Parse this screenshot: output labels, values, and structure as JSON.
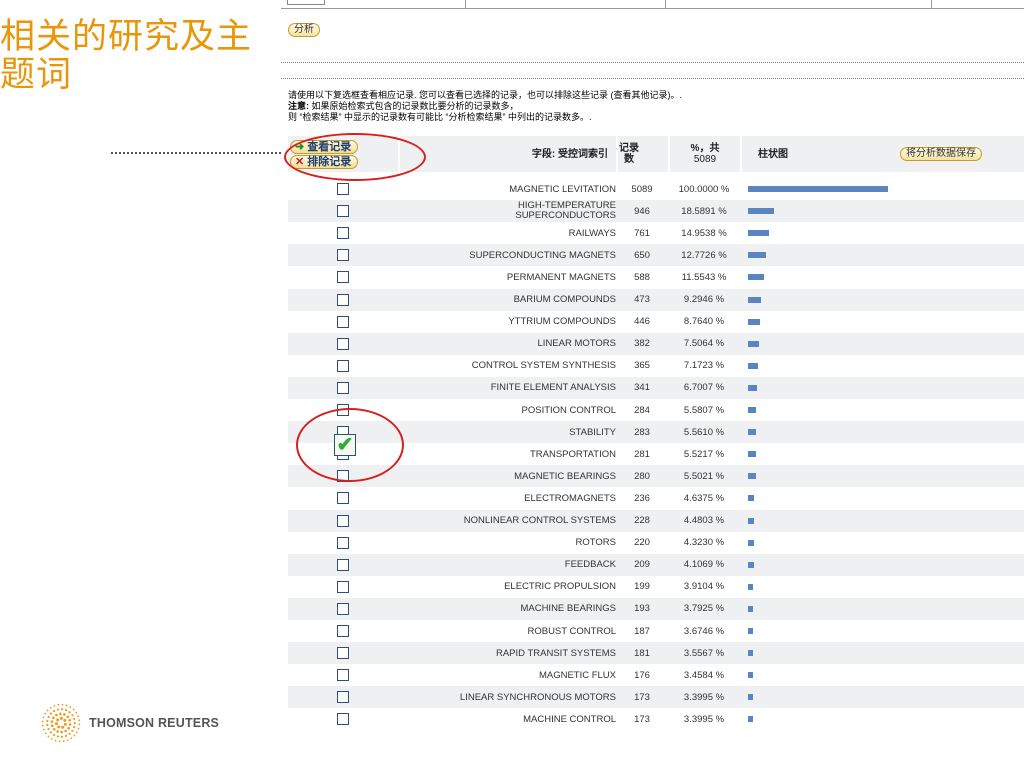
{
  "slide_title": "相关的研究及主题词",
  "analyze_button": "分析",
  "notice": {
    "line1": "请使用以下复选框查看相应记录. 您可以查看已选择的记录，也可以排除这些记录 (查看其他记录)。.",
    "line2_label": "注意:",
    "line2": " 如果原始检索式包含的记录数比要分析的记录数多，",
    "line3": "则 “检索结果” 中显示的记录数有可能比 “分析检索结果” 中列出的记录数多。."
  },
  "table": {
    "view_records_button": "查看记录",
    "exclude_records_button": "排除记录",
    "col_field": "字段: 受控词索引",
    "col_count": "记录数",
    "col_pct_line1": "%，共",
    "col_pct_line2": "5089",
    "col_chart": "柱状图",
    "save_data_button": "将分析数据保存"
  },
  "rows": [
    {
      "term": "MAGNETIC LEVITATION",
      "count": "5089",
      "pct": "100.0000 %",
      "pct_value": 100.0,
      "checked": false
    },
    {
      "term": "HIGH-TEMPERATURE SUPERCONDUCTORS",
      "count": "946",
      "pct": "18.5891 %",
      "pct_value": 18.5891,
      "checked": false
    },
    {
      "term": "RAILWAYS",
      "count": "761",
      "pct": "14.9538 %",
      "pct_value": 14.9538,
      "checked": false
    },
    {
      "term": "SUPERCONDUCTING MAGNETS",
      "count": "650",
      "pct": "12.7726 %",
      "pct_value": 12.7726,
      "checked": false
    },
    {
      "term": "PERMANENT MAGNETS",
      "count": "588",
      "pct": "11.5543 %",
      "pct_value": 11.5543,
      "checked": false
    },
    {
      "term": "BARIUM COMPOUNDS",
      "count": "473",
      "pct": "9.2946 %",
      "pct_value": 9.2946,
      "checked": false
    },
    {
      "term": "YTTRIUM COMPOUNDS",
      "count": "446",
      "pct": "8.7640 %",
      "pct_value": 8.764,
      "checked": false
    },
    {
      "term": "LINEAR MOTORS",
      "count": "382",
      "pct": "7.5064 %",
      "pct_value": 7.5064,
      "checked": false
    },
    {
      "term": "CONTROL SYSTEM SYNTHESIS",
      "count": "365",
      "pct": "7.1723 %",
      "pct_value": 7.1723,
      "checked": false
    },
    {
      "term": "FINITE ELEMENT ANALYSIS",
      "count": "341",
      "pct": "6.7007 %",
      "pct_value": 6.7007,
      "checked": false
    },
    {
      "term": "POSITION CONTROL",
      "count": "284",
      "pct": "5.5807 %",
      "pct_value": 5.5807,
      "checked": false
    },
    {
      "term": "STABILITY",
      "count": "283",
      "pct": "5.5610 %",
      "pct_value": 5.561,
      "checked": true
    },
    {
      "term": "TRANSPORTATION",
      "count": "281",
      "pct": "5.5217 %",
      "pct_value": 5.5217,
      "checked": false
    },
    {
      "term": "MAGNETIC BEARINGS",
      "count": "280",
      "pct": "5.5021 %",
      "pct_value": 5.5021,
      "checked": false
    },
    {
      "term": "ELECTROMAGNETS",
      "count": "236",
      "pct": "4.6375 %",
      "pct_value": 4.6375,
      "checked": false
    },
    {
      "term": "NONLINEAR CONTROL SYSTEMS",
      "count": "228",
      "pct": "4.4803 %",
      "pct_value": 4.4803,
      "checked": false
    },
    {
      "term": "ROTORS",
      "count": "220",
      "pct": "4.3230 %",
      "pct_value": 4.323,
      "checked": false
    },
    {
      "term": "FEEDBACK",
      "count": "209",
      "pct": "4.1069 %",
      "pct_value": 4.1069,
      "checked": false
    },
    {
      "term": "ELECTRIC PROPULSION",
      "count": "199",
      "pct": "3.9104 %",
      "pct_value": 3.9104,
      "checked": false
    },
    {
      "term": "MACHINE BEARINGS",
      "count": "193",
      "pct": "3.7925 %",
      "pct_value": 3.7925,
      "checked": false
    },
    {
      "term": "ROBUST CONTROL",
      "count": "187",
      "pct": "3.6746 %",
      "pct_value": 3.6746,
      "checked": false
    },
    {
      "term": "RAPID TRANSIT SYSTEMS",
      "count": "181",
      "pct": "3.5567 %",
      "pct_value": 3.5567,
      "checked": false
    },
    {
      "term": "MAGNETIC FLUX",
      "count": "176",
      "pct": "3.4584 %",
      "pct_value": 3.4584,
      "checked": false
    },
    {
      "term": "LINEAR SYNCHRONOUS MOTORS",
      "count": "173",
      "pct": "3.3995 %",
      "pct_value": 3.3995,
      "checked": false
    },
    {
      "term": "MACHINE CONTROL",
      "count": "173",
      "pct": "3.3995 %",
      "pct_value": 3.3995,
      "checked": false
    }
  ],
  "logo": {
    "icon": "thomson-reuters-logo-icon",
    "text": "THOMSON REUTERS"
  },
  "colors": {
    "title": "#e8960c",
    "bar": "#5b85c1",
    "annotation": "#d81e1e",
    "check": "#2eab3c"
  }
}
